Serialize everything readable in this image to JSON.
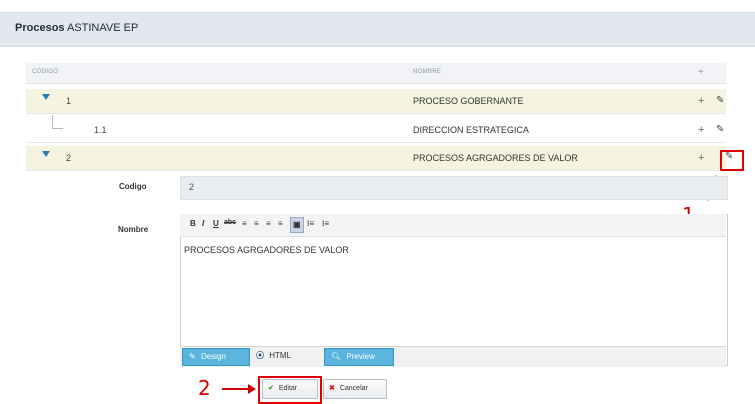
{
  "header": {
    "title_bold": "Procesos",
    "title_rest": "ASTINAVE EP"
  },
  "grid": {
    "col_code": "CÓDIGO",
    "col_name": "NOMBRE",
    "add_icon": "plus-icon",
    "rows": [
      {
        "code": "1",
        "name": "PROCESO GOBERNANTE"
      },
      {
        "code": "1.1",
        "name": "DIRECCION ESTRATEGICA"
      },
      {
        "code": "2",
        "name": "PROCESOS AGRGADORES DE VALOR"
      }
    ]
  },
  "form": {
    "codigo_label": "Codigo",
    "codigo_value": "2",
    "nombre_label": "Nombre",
    "editor_text": "PROCESOS AGRGADORES DE VALOR",
    "toolbar": [
      "B",
      "I",
      "U",
      "abc",
      "≡",
      "≡",
      "≡",
      "≡",
      "▣",
      "⁝≡",
      "⁝≡"
    ],
    "modes": {
      "design": "Design",
      "html": "HTML",
      "preview": "Preview"
    },
    "edit_button": "Editar",
    "cancel_button": "Cancelar"
  },
  "annotations": {
    "one": "1",
    "two": "2"
  },
  "colors": {
    "highlight_row": "#f4f4e1",
    "accent": "#2a7ab8",
    "mode_active": "#5ab4dd",
    "annotation": "#d10000"
  }
}
